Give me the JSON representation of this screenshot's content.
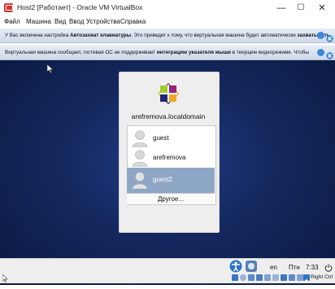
{
  "window": {
    "title": "Host2 [Работает] - Oracle VM VirtualBox",
    "minimize": "—",
    "maximize": "☐",
    "close": "✕"
  },
  "menu": [
    "Файл",
    "Машина",
    "Вид",
    "Ввод",
    "Устройства",
    "Справка"
  ],
  "notifications": {
    "keyboard": {
      "pre": "У Вас включена настройка ",
      "bold1": "Автозахват клавиатуры",
      "mid": ". Это приведет к тому, что виртуальная машина будет автоматически ",
      "bold2": "захватывать"
    },
    "mouse": {
      "pre": "Виртуальная машина сообщает, гостевая ОС не поддерживает ",
      "bold1": "интеграцию указателя мыши",
      "post": " в текущем видеорежиме. Чтобы"
    }
  },
  "login": {
    "hostname": "arefremova.localdomain",
    "users": [
      {
        "name": "guest",
        "selected": false
      },
      {
        "name": "arefremova",
        "selected": false
      },
      {
        "name": "guest2",
        "selected": true
      }
    ],
    "other": "Другое..."
  },
  "status_bar": {
    "language": "en",
    "day": "Птн",
    "time": "7:33"
  },
  "tray": {
    "host_key": "Right Ctrl"
  },
  "colors": {
    "background": "#14285e",
    "selection": "#8fa7c6",
    "notification_icon": "#3b86e0"
  },
  "icons": {
    "app": "virtualbox-icon",
    "logo": "centos-logo",
    "user": "user-avatar-icon",
    "accessibility": "accessibility-icon",
    "power": "power-icon"
  }
}
